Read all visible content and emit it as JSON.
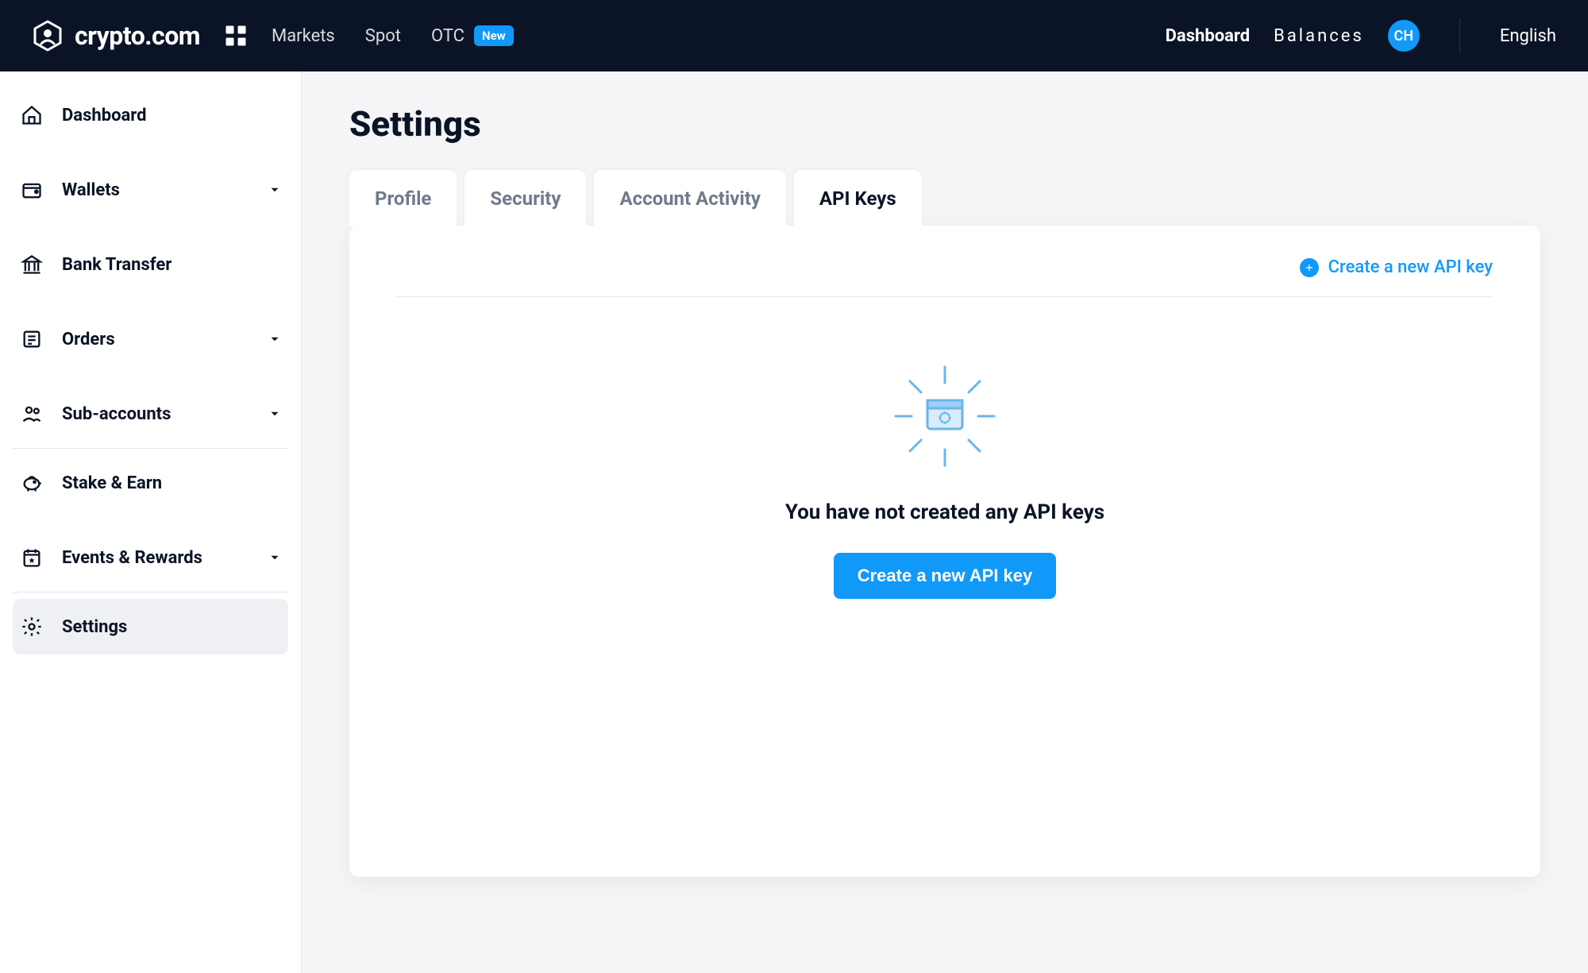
{
  "brand": {
    "name": "crypto.com"
  },
  "topnav": {
    "markets": "Markets",
    "spot": "Spot",
    "otc": "OTC",
    "otc_badge": "New"
  },
  "topright": {
    "dashboard": "Dashboard",
    "balances": "Balances",
    "avatar_initials": "CH",
    "language": "English"
  },
  "sidebar": {
    "items": [
      {
        "label": "Dashboard",
        "expandable": false
      },
      {
        "label": "Wallets",
        "expandable": true
      },
      {
        "label": "Bank Transfer",
        "expandable": false
      },
      {
        "label": "Orders",
        "expandable": true
      },
      {
        "label": "Sub-accounts",
        "expandable": true
      },
      {
        "label": "Stake & Earn",
        "expandable": false
      },
      {
        "label": "Events & Rewards",
        "expandable": true
      },
      {
        "label": "Settings",
        "expandable": false
      }
    ]
  },
  "page": {
    "title": "Settings"
  },
  "tabs": {
    "profile": "Profile",
    "security": "Security",
    "activity": "Account Activity",
    "api_keys": "API Keys"
  },
  "api_panel": {
    "create_link": "Create a new API key",
    "empty_heading": "You have not created any API keys",
    "empty_button": "Create a new API key"
  }
}
